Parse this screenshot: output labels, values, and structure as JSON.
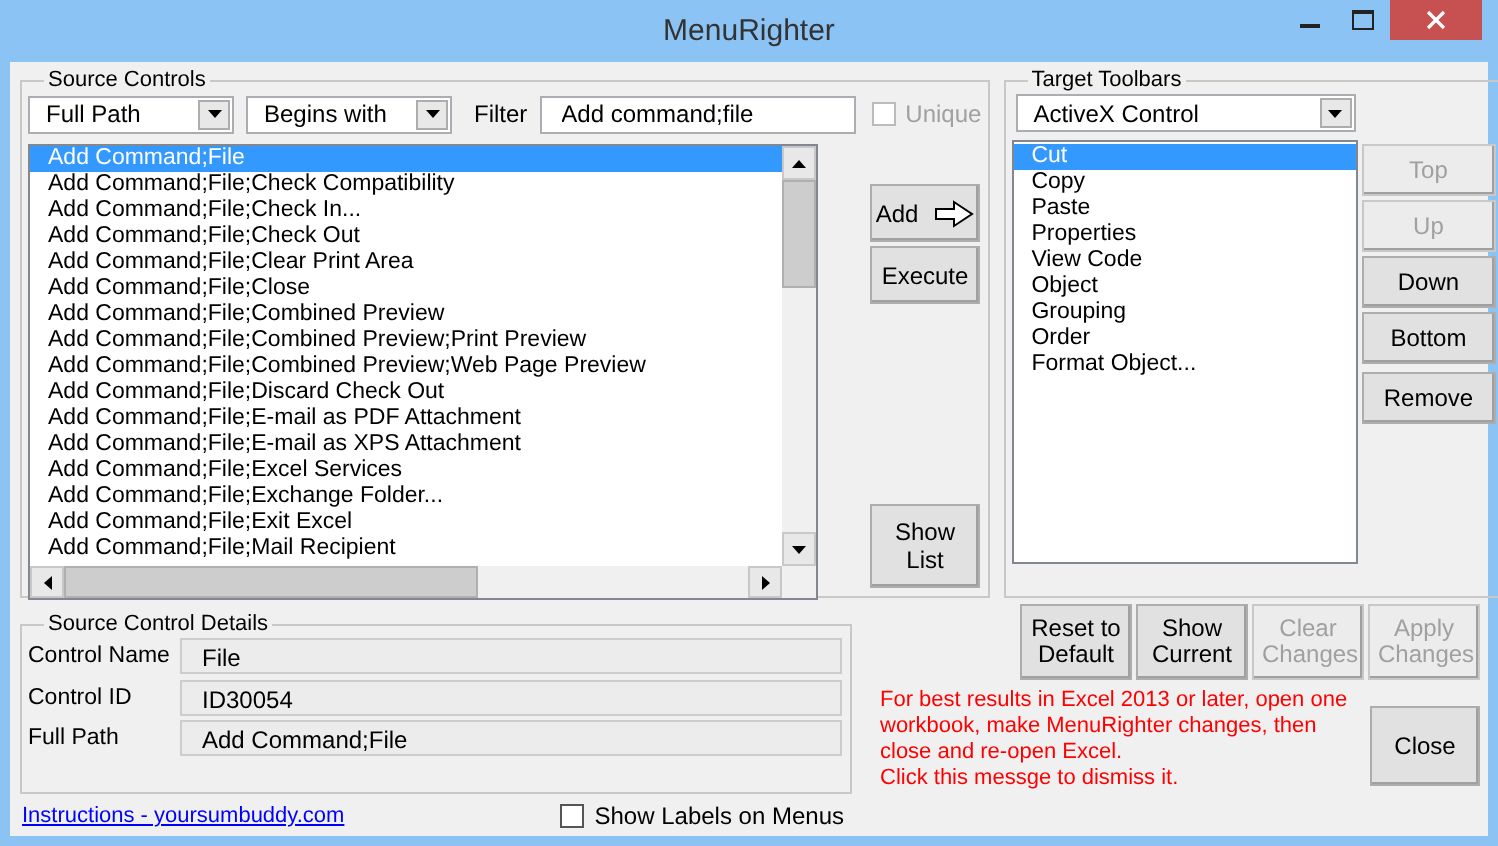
{
  "window": {
    "title": "MenuRighter"
  },
  "source_controls": {
    "title": "Source Controls",
    "mode_select": "Full Path",
    "match_select": "Begins with",
    "filter_label": "Filter",
    "filter_value": "Add command;file",
    "unique": {
      "label": "Unique",
      "checked": false,
      "disabled": true
    },
    "items": [
      {
        "label": "Add Command;File",
        "selected": true
      },
      {
        "label": "Add Command;File;Check Compatibility",
        "selected": false
      },
      {
        "label": "Add Command;File;Check In...",
        "selected": false
      },
      {
        "label": "Add Command;File;Check Out",
        "selected": false
      },
      {
        "label": "Add Command;File;Clear Print Area",
        "selected": false
      },
      {
        "label": "Add Command;File;Close",
        "selected": false
      },
      {
        "label": "Add Command;File;Combined Preview",
        "selected": false
      },
      {
        "label": "Add Command;File;Combined Preview;Print Preview",
        "selected": false
      },
      {
        "label": "Add Command;File;Combined Preview;Web Page Preview",
        "selected": false
      },
      {
        "label": "Add Command;File;Discard Check Out",
        "selected": false
      },
      {
        "label": "Add Command;File;E-mail as PDF Attachment",
        "selected": false
      },
      {
        "label": "Add Command;File;E-mail as XPS Attachment",
        "selected": false
      },
      {
        "label": "Add Command;File;Excel Services",
        "selected": false
      },
      {
        "label": "Add Command;File;Exchange Folder...",
        "selected": false
      },
      {
        "label": "Add Command;File;Exit Excel",
        "selected": false
      },
      {
        "label": "Add Command;File;Mail Recipient",
        "selected": false
      }
    ],
    "buttons": [
      {
        "label": "Add",
        "kind": "arrow"
      },
      {
        "label": "Execute",
        "kind": "plain"
      },
      {
        "label": "Show List",
        "kind": "tall"
      }
    ]
  },
  "target_toolbars": {
    "title": "Target Toolbars",
    "toolbar_select": "ActiveX Control",
    "items": [
      {
        "label": "Cut",
        "selected": true
      },
      {
        "label": "Copy",
        "selected": false
      },
      {
        "label": "Paste",
        "selected": false
      },
      {
        "label": "Properties",
        "selected": false
      },
      {
        "label": "View Code",
        "selected": false
      },
      {
        "label": "Object",
        "selected": false
      },
      {
        "label": "Grouping",
        "selected": false
      },
      {
        "label": "Order",
        "selected": false
      },
      {
        "label": "Format Object...",
        "selected": false
      }
    ],
    "buttons": [
      {
        "label": "Top",
        "disabled": true
      },
      {
        "label": "Up",
        "disabled": true
      },
      {
        "label": "Down",
        "disabled": false
      },
      {
        "label": "Bottom",
        "disabled": false
      },
      {
        "label": "Remove",
        "disabled": false
      }
    ]
  },
  "details": {
    "title": "Source Control Details",
    "fields": [
      {
        "label": "Control Name",
        "value": "File"
      },
      {
        "label": "Control ID",
        "value": "ID30054"
      },
      {
        "label": "Full Path",
        "value": "Add Command;File"
      }
    ]
  },
  "instructions_link": "Instructions - yoursumbuddy.com",
  "show_labels": {
    "label": "Show Labels on Menus",
    "checked": false
  },
  "action_buttons": [
    {
      "label": "Reset to Default",
      "disabled": false
    },
    {
      "label": "Show Current",
      "disabled": false
    },
    {
      "label": "Clear Changes",
      "disabled": true
    },
    {
      "label": "Apply Changes",
      "disabled": true
    }
  ],
  "message": "For best results in Excel 2013 or later, open one workbook, make MenuRighter changes, then close and re-open Excel.\nClick this messge to dismiss it.",
  "close_button": "Close"
}
